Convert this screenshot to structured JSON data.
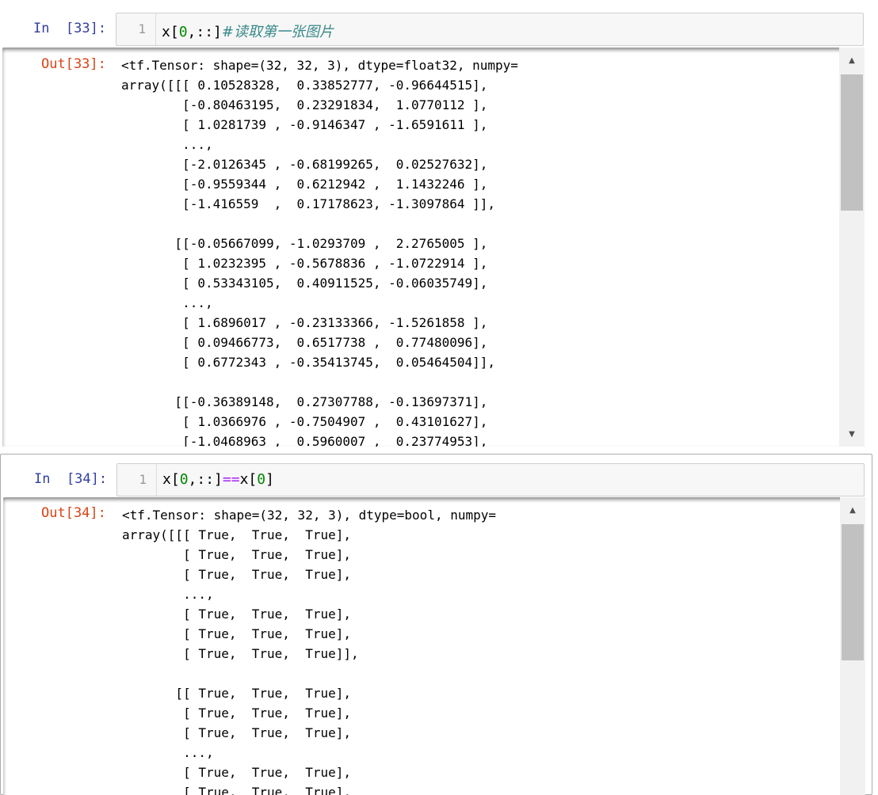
{
  "cells": [
    {
      "in_prompt": "In  [33]:",
      "line_number": "1",
      "code": {
        "p1": "x[",
        "p2": "0",
        "p3": ",::]",
        "comment": "#读取第一张图片"
      },
      "out_prompt": "Out[33]:",
      "output": "<tf.Tensor: shape=(32, 32, 3), dtype=float32, numpy=\narray([[[ 0.10528328,  0.33852777, -0.96644515],\n        [-0.80463195,  0.23291834,  1.0770112 ],\n        [ 1.0281739 , -0.9146347 , -1.6591611 ],\n        ...,\n        [-2.0126345 , -0.68199265,  0.02527632],\n        [-0.9559344 ,  0.6212942 ,  1.1432246 ],\n        [-1.416559  ,  0.17178623, -1.3097864 ]],\n\n       [[-0.05667099, -1.0293709 ,  2.2765005 ],\n        [ 1.0232395 , -0.5678836 , -1.0722914 ],\n        [ 0.53343105,  0.40911525, -0.06035749],\n        ...,\n        [ 1.6896017 , -0.23133366, -1.5261858 ],\n        [ 0.09466773,  0.6517738 ,  0.77480096],\n        [ 0.6772343 , -0.35413745,  0.05464504]],\n\n       [[-0.36389148,  0.27307788, -0.13697371],\n        [ 1.0366976 , -0.7504907 ,  0.43101627],\n        [-1.0468963 ,  0.5960007 ,  0.23774953],",
      "scroll_up_glyph": "▲",
      "scroll_down_glyph": "▼"
    },
    {
      "in_prompt": "In  [34]:",
      "line_number": "1",
      "code": {
        "p1": "x[",
        "p2": "0",
        "p3": ",::]",
        "p4": "==",
        "p5": "x[",
        "p6": "0",
        "p7": "]"
      },
      "out_prompt": "Out[34]:",
      "output": "<tf.Tensor: shape=(32, 32, 3), dtype=bool, numpy=\narray([[[ True,  True,  True],\n        [ True,  True,  True],\n        [ True,  True,  True],\n        ...,\n        [ True,  True,  True],\n        [ True,  True,  True],\n        [ True,  True,  True]],\n\n       [[ True,  True,  True],\n        [ True,  True,  True],\n        [ True,  True,  True],\n        ...,\n        [ True,  True,  True],\n        [ True,  True,  True],",
      "scroll_up_glyph": "▲"
    }
  ],
  "colors": {
    "in_prompt": "#303f9f",
    "out_prompt": "#d84315",
    "number": "#008800",
    "operator": "#aa22ff",
    "comment": "#3a8a8a"
  }
}
